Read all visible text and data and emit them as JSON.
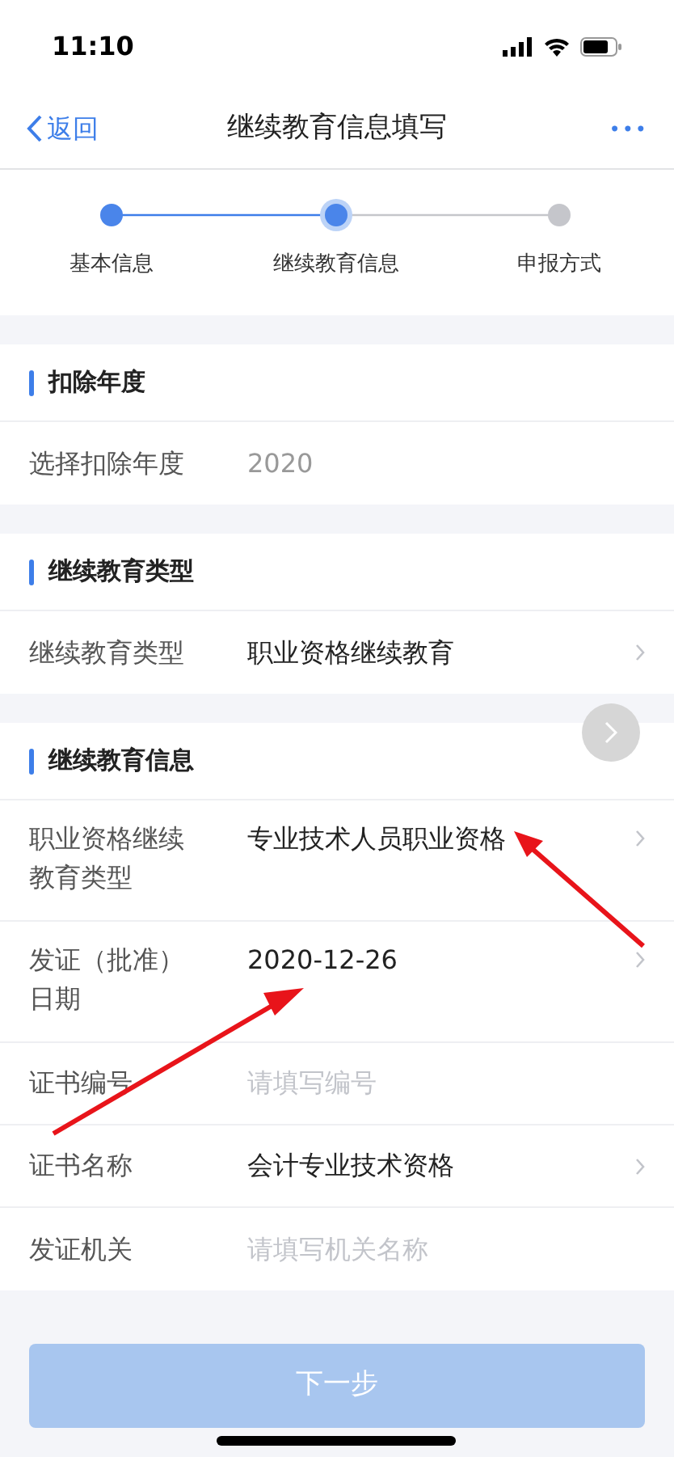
{
  "status_bar": {
    "time": "11:10"
  },
  "nav": {
    "back": "返回",
    "title": "继续教育信息填写",
    "more": "•••"
  },
  "steps": [
    {
      "label": "基本信息",
      "completed": true,
      "selected": false
    },
    {
      "label": "继续教育信息",
      "completed": true,
      "selected": true
    },
    {
      "label": "申报方式",
      "completed": false,
      "selected": false
    }
  ],
  "sections": [
    {
      "title": "扣除年度",
      "rows": [
        {
          "kind": "readonly",
          "label": "选择扣除年度",
          "value": "2020"
        }
      ]
    },
    {
      "title": "继续教育类型",
      "rows": [
        {
          "kind": "select",
          "label": "继续教育类型",
          "value": "职业资格继续教育"
        }
      ]
    },
    {
      "title": "继续教育信息",
      "rows": [
        {
          "kind": "select",
          "label": "职业资格继续教育类型",
          "value": "专业技术人员职业资格"
        },
        {
          "kind": "select",
          "label": "发证（批准）日期",
          "value": "2020-12-26"
        },
        {
          "kind": "input",
          "label": "证书编号",
          "placeholder": "请填写编号"
        },
        {
          "kind": "select",
          "label": "证书名称",
          "value": "会计专业技术资格"
        },
        {
          "kind": "input",
          "label": "发证机关",
          "placeholder": "请填写机关名称"
        }
      ]
    }
  ],
  "next_button": {
    "label": "下一步",
    "disabled": true
  }
}
